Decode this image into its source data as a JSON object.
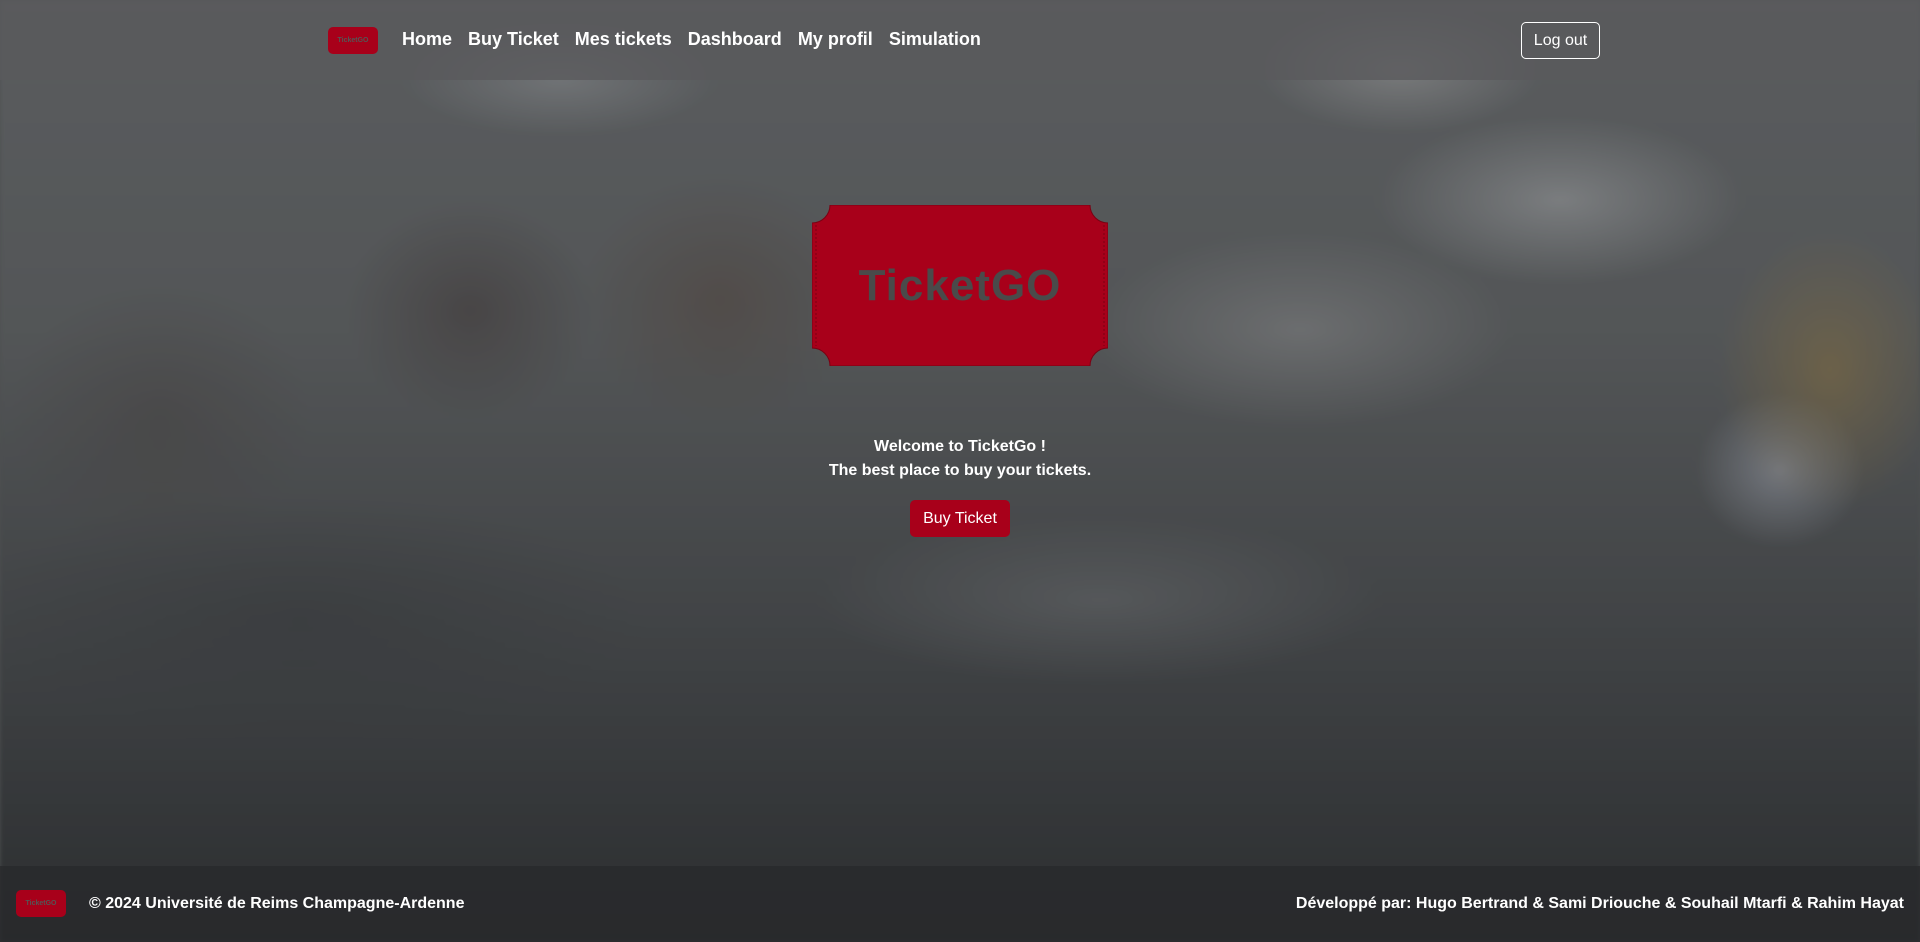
{
  "brand": {
    "name": "TicketGO",
    "small_logo_text": "TicketGO",
    "accent": "#a8001a"
  },
  "nav": {
    "links": [
      "Home",
      "Buy Ticket",
      "Mes tickets",
      "Dashboard",
      "My profil",
      "Simulation"
    ],
    "logout_label": "Log out"
  },
  "hero": {
    "welcome": "Welcome to TicketGo !",
    "tagline": "The best place to buy your tickets.",
    "cta_label": "Buy Ticket"
  },
  "footer": {
    "copyright": "© 2024 Université de Reims Champagne-Ardenne",
    "developers": "Développé par: Hugo Bertrand & Sami Driouche & Souhail Mtarfi & Rahim Hayat"
  }
}
